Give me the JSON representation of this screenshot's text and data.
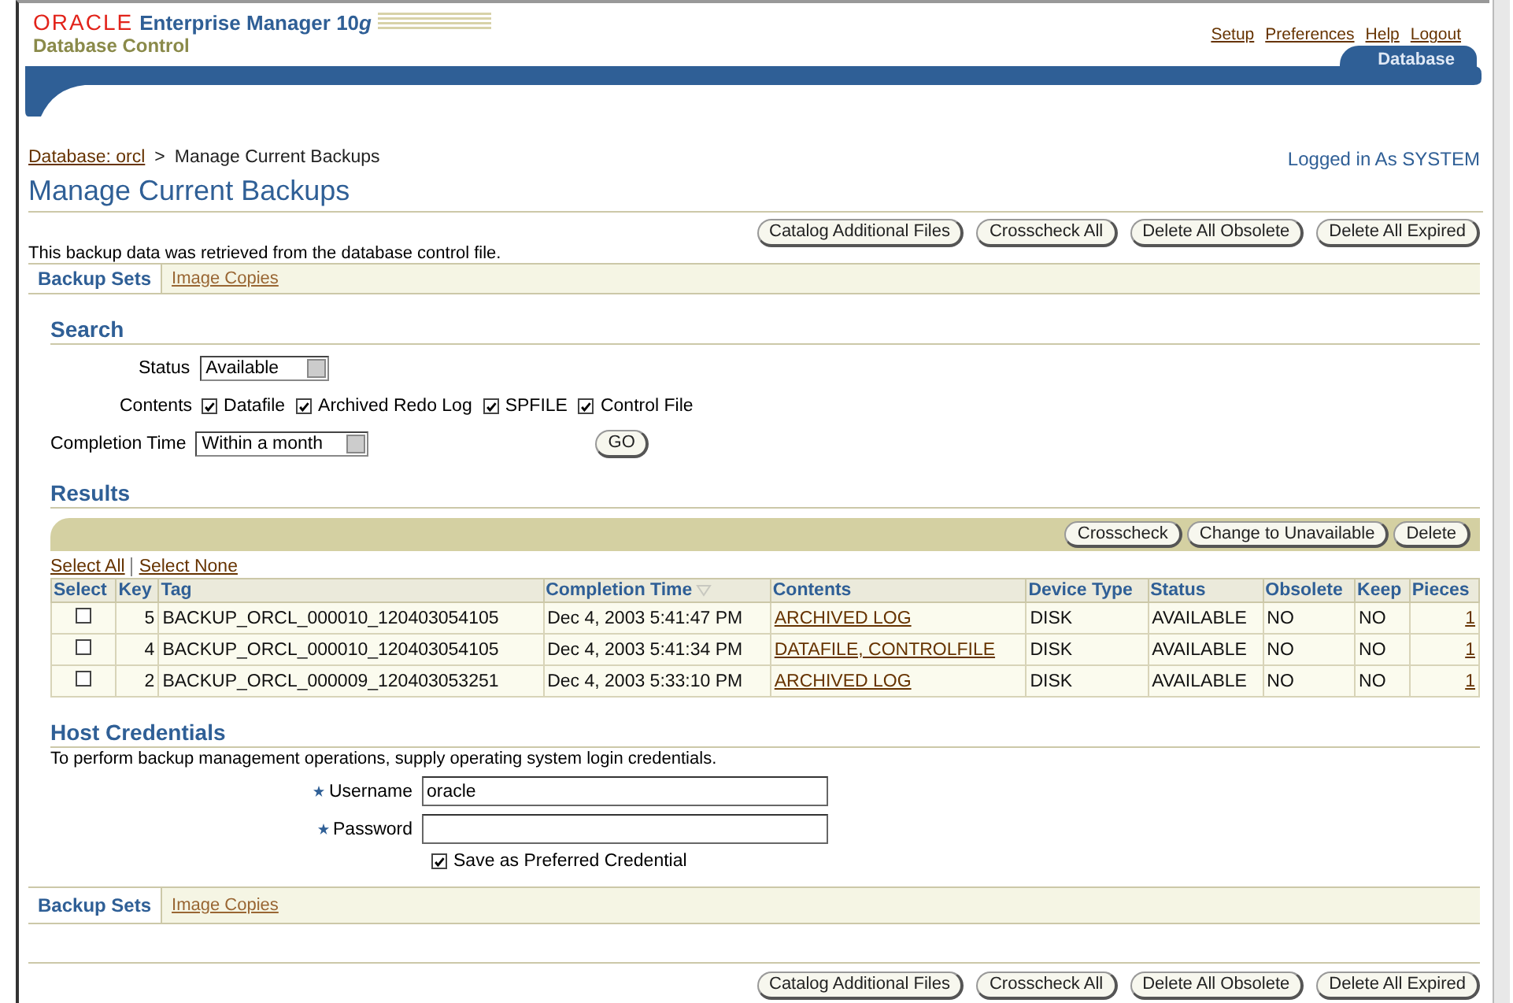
{
  "header": {
    "brand": "ORACLE",
    "product": "Enterprise Manager 10",
    "product_suffix": "g",
    "subtitle": "Database Control",
    "links": [
      "Setup",
      "Preferences",
      "Help",
      "Logout"
    ],
    "tabs": [
      {
        "label": "Database",
        "selected": true
      }
    ]
  },
  "breadcrumb": [
    {
      "label": "Database: orcl",
      "link": true
    },
    {
      "label": ">",
      "link": false
    },
    {
      "label": "Manage Current Backups",
      "link": false
    }
  ],
  "logged_in": "Logged in As SYSTEM",
  "title": "Manage Current Backups",
  "top_buttons": [
    "Catalog Additional Files",
    "Crosscheck All",
    "Delete All Obsolete",
    "Delete All Expired"
  ],
  "info": "This backup data was retrieved from the database control file.",
  "subtabs": [
    {
      "label": "Backup Sets",
      "selected": true
    },
    {
      "label": "Image Copies",
      "selected": false
    }
  ],
  "search": {
    "title": "Search",
    "status": {
      "label": "Status",
      "value": "Available"
    },
    "contents": {
      "label": "Contents",
      "options": [
        {
          "label": "Datafile",
          "checked": true
        },
        {
          "label": "Archived Redo Log",
          "checked": true
        },
        {
          "label": "SPFILE",
          "checked": true
        },
        {
          "label": "Control File",
          "checked": true
        }
      ]
    },
    "completion_time": {
      "label": "Completion Time",
      "value": "Within a month"
    },
    "go": "GO"
  },
  "results": {
    "title": "Results",
    "buttons": [
      "Crosscheck",
      "Change to Unavailable",
      "Delete"
    ],
    "select_all": "Select All",
    "select_none": "Select None",
    "columns": [
      {
        "label": "Select",
        "sorted": false
      },
      {
        "label": "Key",
        "sorted": false
      },
      {
        "label": "Tag",
        "sorted": false
      },
      {
        "label": "Completion Time",
        "sorted": true
      },
      {
        "label": "Contents",
        "sorted": false
      },
      {
        "label": "Device Type",
        "sorted": false
      },
      {
        "label": "Status",
        "sorted": false
      },
      {
        "label": "Obsolete",
        "sorted": false
      },
      {
        "label": "Keep",
        "sorted": false
      },
      {
        "label": "Pieces",
        "sorted": false
      }
    ],
    "rows": [
      {
        "checked": false,
        "key": "5",
        "tag": "BACKUP_ORCL_000010_120403054105",
        "completion_time": "Dec 4, 2003 5:41:47 PM",
        "contents": "ARCHIVED LOG",
        "device_type": "DISK",
        "status": "AVAILABLE",
        "obsolete": "NO",
        "keep": "NO",
        "pieces": "1"
      },
      {
        "checked": false,
        "key": "4",
        "tag": "BACKUP_ORCL_000010_120403054105",
        "completion_time": "Dec 4, 2003 5:41:34 PM",
        "contents": "DATAFILE, CONTROLFILE",
        "device_type": "DISK",
        "status": "AVAILABLE",
        "obsolete": "NO",
        "keep": "NO",
        "pieces": "1"
      },
      {
        "checked": false,
        "key": "2",
        "tag": "BACKUP_ORCL_000009_120403053251",
        "completion_time": "Dec 4, 2003 5:33:10 PM",
        "contents": "ARCHIVED LOG",
        "device_type": "DISK",
        "status": "AVAILABLE",
        "obsolete": "NO",
        "keep": "NO",
        "pieces": "1"
      }
    ]
  },
  "host_credentials": {
    "title": "Host Credentials",
    "description": "To perform backup management operations, supply operating system login credentials.",
    "fields": [
      {
        "label": "Username",
        "required": true,
        "value": "oracle"
      },
      {
        "label": "Password",
        "required": true
      }
    ],
    "save": {
      "label": "Save as Preferred Credential",
      "checked": true
    }
  },
  "bottom_subtabs": [
    {
      "label": "Backup Sets",
      "selected": true
    },
    {
      "label": "Image Copies",
      "selected": false
    }
  ],
  "bottom_buttons": [
    "Catalog Additional Files",
    "Crosscheck All",
    "Delete All Obsolete",
    "Delete All Expired"
  ]
}
